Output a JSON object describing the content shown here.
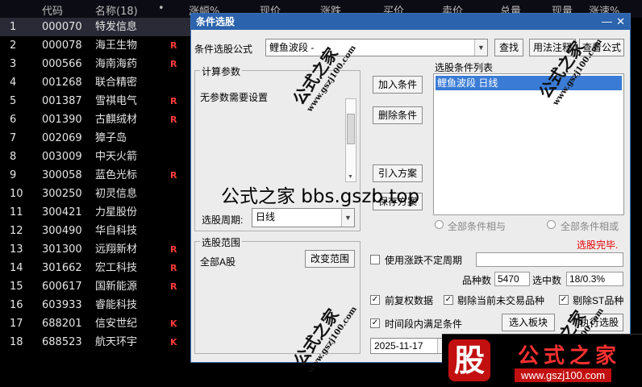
{
  "list_header": [
    "代码",
    "名称(18)",
    "•",
    "涨幅%",
    "现价",
    "涨跌",
    "买价",
    "卖价",
    "总量",
    "现量",
    "涨速%"
  ],
  "stocks": [
    {
      "idx": "1",
      "code": "000070",
      "name": "特发信息",
      "flag": ""
    },
    {
      "idx": "2",
      "code": "000078",
      "name": "海王生物",
      "flag": "R"
    },
    {
      "idx": "3",
      "code": "000566",
      "name": "海南海药",
      "flag": "R"
    },
    {
      "idx": "4",
      "code": "001268",
      "name": "联合精密",
      "flag": ""
    },
    {
      "idx": "5",
      "code": "001387",
      "name": "雪祺电气",
      "flag": "R"
    },
    {
      "idx": "6",
      "code": "001390",
      "name": "古麒绒材",
      "flag": "R"
    },
    {
      "idx": "7",
      "code": "002069",
      "name": "獐子岛",
      "flag": ""
    },
    {
      "idx": "8",
      "code": "003009",
      "name": "中天火箭",
      "flag": ""
    },
    {
      "idx": "9",
      "code": "300058",
      "name": "蓝色光标",
      "flag": "R"
    },
    {
      "idx": "10",
      "code": "300250",
      "name": "初灵信息",
      "flag": ""
    },
    {
      "idx": "11",
      "code": "300421",
      "name": "力星股份",
      "flag": ""
    },
    {
      "idx": "12",
      "code": "300490",
      "name": "华自科技",
      "flag": ""
    },
    {
      "idx": "13",
      "code": "301300",
      "name": "远翔新材",
      "flag": "R"
    },
    {
      "idx": "14",
      "code": "301662",
      "name": "宏工科技",
      "flag": "R"
    },
    {
      "idx": "15",
      "code": "600617",
      "name": "国新能源",
      "flag": "R"
    },
    {
      "idx": "16",
      "code": "603933",
      "name": "睿能科技",
      "flag": ""
    },
    {
      "idx": "17",
      "code": "688201",
      "name": "信安世纪",
      "flag": "K"
    },
    {
      "idx": "18",
      "code": "688523",
      "name": "航天环宇",
      "flag": "K"
    }
  ],
  "dialog": {
    "title": "条件选股",
    "formula_label": "条件选股公式",
    "formula_value": "鲤鱼波段 -",
    "find_btn": "查找",
    "usage_btn": "用法注释",
    "view_formula_btn": "查看公式",
    "params_caption": "计算参数",
    "params_text": "无参数需要设置",
    "add_cond_btn": "加入条件",
    "del_cond_btn": "删除条件",
    "import_btn": "引入方案",
    "save_btn": "保存方案",
    "cond_list_caption": "选股条件列表",
    "cond_items": [
      "鲤鱼波段 日线"
    ],
    "period_label": "选股周期:",
    "period_value": "日线",
    "all_and": "全部条件相与",
    "all_or": "全部条件相或",
    "status": "选股完毕.",
    "scope_caption": "选股范围",
    "scope_value": "全部A股",
    "change_scope_btn": "改变范围",
    "use_uncertain": "使用涨跌不定周期",
    "count_label": "品种数",
    "count_value": "5470",
    "selected_label": "选中数",
    "selected_value": "18/0.3%",
    "pre_adjust": "前复权数据",
    "exclude_untraded": "剔除当前未交易品种",
    "exclude_st": "剔除ST品种",
    "time_range": "时间段内满足条件",
    "to_board_btn": "选入板块",
    "exec_btn": "执行选股",
    "date_value": "2025-11-17"
  },
  "overlay": "公式之家 bbs.gszb.top",
  "watermark": {
    "name": "公式之家",
    "url": "www.gszj100.com"
  },
  "logo": {
    "char": "股",
    "name": "公式之家",
    "url": "www.gszj100.com"
  },
  "colors": {
    "title_bar": "#2b63ad",
    "status": "#e60000",
    "flag_r": "#ff3a3a",
    "selection": "#3a7bd5"
  }
}
